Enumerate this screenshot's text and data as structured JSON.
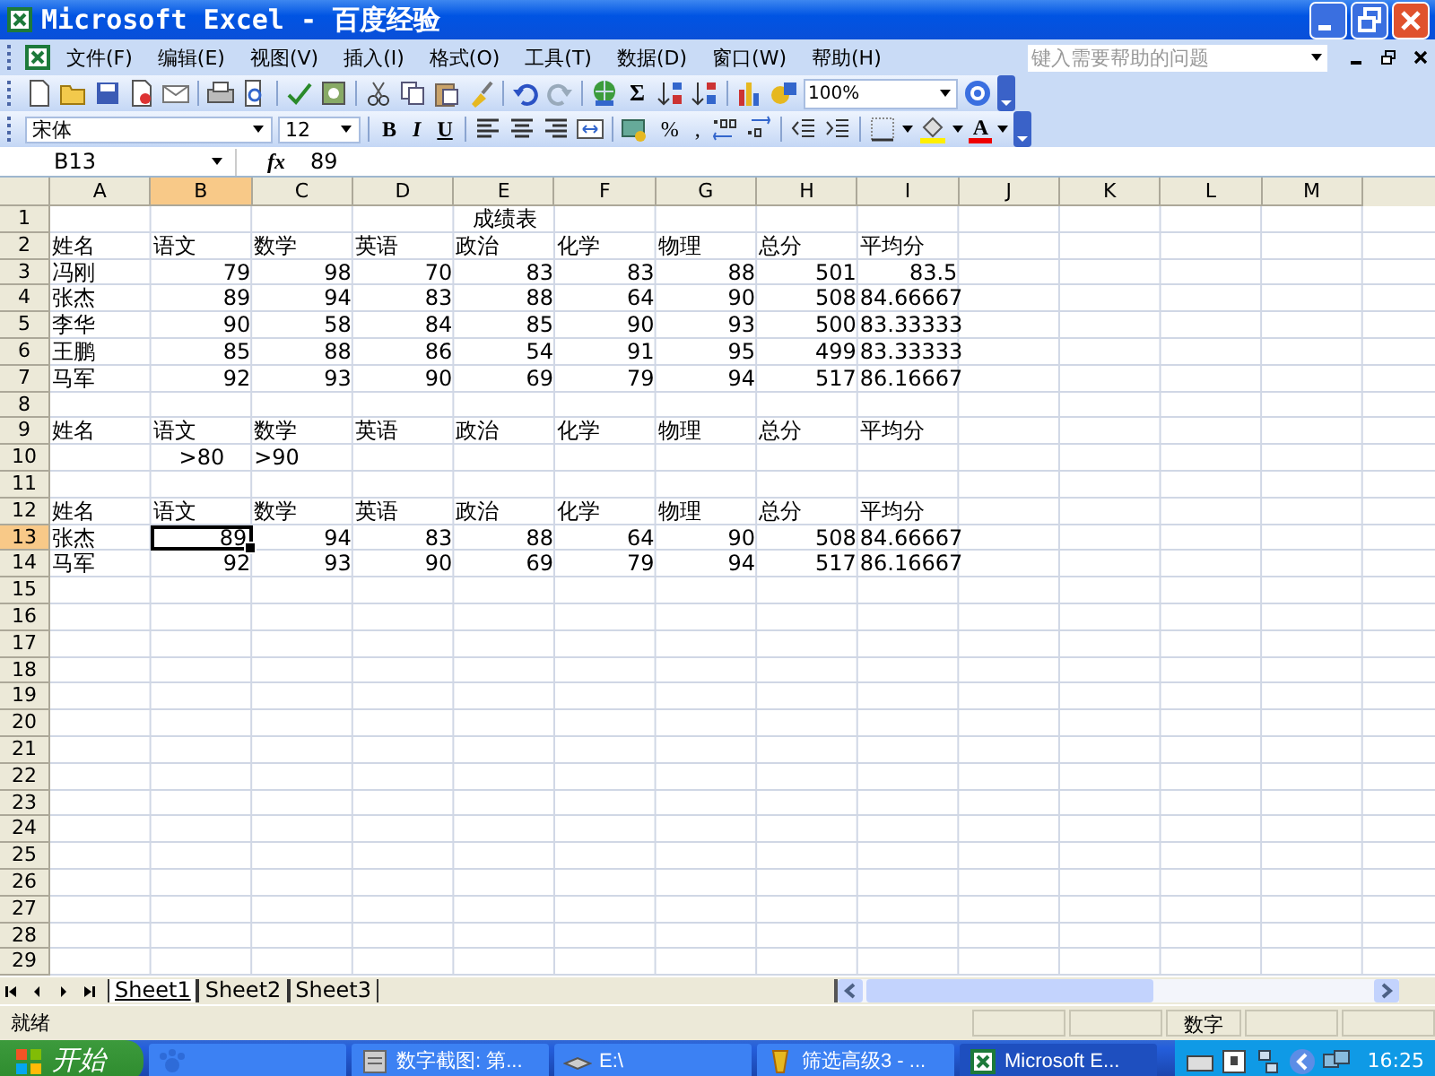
{
  "window": {
    "title": "Microsoft Excel - 百度经验"
  },
  "menu": [
    "文件(F)",
    "编辑(E)",
    "视图(V)",
    "插入(I)",
    "格式(O)",
    "工具(T)",
    "数据(D)",
    "窗口(W)",
    "帮助(H)"
  ],
  "help_box": {
    "placeholder": "键入需要帮助的问题"
  },
  "toolbar": {
    "sum": "Σ",
    "zoom": "100%"
  },
  "format_toolbar": {
    "font": "宋体",
    "size": "12",
    "bold": "B",
    "italic": "I",
    "underline": "U",
    "percent": "%",
    "comma": ",",
    "font_color": "A"
  },
  "formula_bar": {
    "name_box": "B13",
    "fx": "fx",
    "value": "89"
  },
  "columns": [
    {
      "label": "A",
      "selected": false
    },
    {
      "label": "B",
      "selected": true
    },
    {
      "label": "C",
      "selected": false
    },
    {
      "label": "D",
      "selected": false
    },
    {
      "label": "E",
      "selected": false
    },
    {
      "label": "F",
      "selected": false
    },
    {
      "label": "G",
      "selected": false
    },
    {
      "label": "H",
      "selected": false
    },
    {
      "label": "I",
      "selected": false
    },
    {
      "label": "J",
      "selected": false
    },
    {
      "label": "K",
      "selected": false
    },
    {
      "label": "L",
      "selected": false
    },
    {
      "label": "M",
      "selected": false
    }
  ],
  "rows": [
    {
      "label": "1",
      "selected": false,
      "cells": [
        null,
        null,
        null,
        null,
        {
          "text": "成绩表",
          "kind": "title"
        }
      ]
    },
    {
      "label": "2",
      "selected": false,
      "cells": [
        {
          "text": "姓名",
          "kind": "text"
        },
        {
          "text": "语文",
          "kind": "text"
        },
        {
          "text": "数学",
          "kind": "text"
        },
        {
          "text": "英语",
          "kind": "text"
        },
        {
          "text": "政治",
          "kind": "text"
        },
        {
          "text": "化学",
          "kind": "text"
        },
        {
          "text": "物理",
          "kind": "text"
        },
        {
          "text": "总分",
          "kind": "text"
        },
        {
          "text": "平均分",
          "kind": "text"
        }
      ]
    },
    {
      "label": "3",
      "selected": false,
      "cells": [
        {
          "text": "冯刚",
          "kind": "text"
        },
        {
          "text": "79",
          "kind": "number"
        },
        {
          "text": "98",
          "kind": "number"
        },
        {
          "text": "70",
          "kind": "number"
        },
        {
          "text": "83",
          "kind": "number"
        },
        {
          "text": "83",
          "kind": "number"
        },
        {
          "text": "88",
          "kind": "number"
        },
        {
          "text": "501",
          "kind": "number"
        },
        {
          "text": "83.5",
          "kind": "number"
        }
      ]
    },
    {
      "label": "4",
      "selected": false,
      "cells": [
        {
          "text": "张杰",
          "kind": "text"
        },
        {
          "text": "89",
          "kind": "number"
        },
        {
          "text": "94",
          "kind": "number"
        },
        {
          "text": "83",
          "kind": "number"
        },
        {
          "text": "88",
          "kind": "number"
        },
        {
          "text": "64",
          "kind": "number"
        },
        {
          "text": "90",
          "kind": "number"
        },
        {
          "text": "508",
          "kind": "number"
        },
        {
          "text": "84.66667",
          "kind": "number"
        }
      ]
    },
    {
      "label": "5",
      "selected": false,
      "cells": [
        {
          "text": "李华",
          "kind": "text"
        },
        {
          "text": "90",
          "kind": "number"
        },
        {
          "text": "58",
          "kind": "number"
        },
        {
          "text": "84",
          "kind": "number"
        },
        {
          "text": "85",
          "kind": "number"
        },
        {
          "text": "90",
          "kind": "number"
        },
        {
          "text": "93",
          "kind": "number"
        },
        {
          "text": "500",
          "kind": "number"
        },
        {
          "text": "83.33333",
          "kind": "number"
        }
      ]
    },
    {
      "label": "6",
      "selected": false,
      "cells": [
        {
          "text": "王鹏",
          "kind": "text"
        },
        {
          "text": "85",
          "kind": "number"
        },
        {
          "text": "88",
          "kind": "number"
        },
        {
          "text": "86",
          "kind": "number"
        },
        {
          "text": "54",
          "kind": "number"
        },
        {
          "text": "91",
          "kind": "number"
        },
        {
          "text": "95",
          "kind": "number"
        },
        {
          "text": "499",
          "kind": "number"
        },
        {
          "text": "83.33333",
          "kind": "number"
        }
      ]
    },
    {
      "label": "7",
      "selected": false,
      "cells": [
        {
          "text": "马军",
          "kind": "text"
        },
        {
          "text": "92",
          "kind": "number"
        },
        {
          "text": "93",
          "kind": "number"
        },
        {
          "text": "90",
          "kind": "number"
        },
        {
          "text": "69",
          "kind": "number"
        },
        {
          "text": "79",
          "kind": "number"
        },
        {
          "text": "94",
          "kind": "number"
        },
        {
          "text": "517",
          "kind": "number"
        },
        {
          "text": "86.16667",
          "kind": "number"
        }
      ]
    },
    {
      "label": "8",
      "selected": false
    },
    {
      "label": "9",
      "selected": false,
      "cells": [
        {
          "text": "姓名",
          "kind": "text"
        },
        {
          "text": "语文",
          "kind": "text"
        },
        {
          "text": "数学",
          "kind": "text"
        },
        {
          "text": "英语",
          "kind": "text"
        },
        {
          "text": "政治",
          "kind": "text"
        },
        {
          "text": "化学",
          "kind": "text"
        },
        {
          "text": "物理",
          "kind": "text"
        },
        {
          "text": "总分",
          "kind": "text"
        },
        {
          "text": "平均分",
          "kind": "text"
        }
      ]
    },
    {
      "label": "10",
      "selected": false,
      "cells": [
        null,
        {
          "text": ">80",
          "kind": "title"
        },
        {
          "text": ">90",
          "kind": "text"
        }
      ]
    },
    {
      "label": "11",
      "selected": false
    },
    {
      "label": "12",
      "selected": false,
      "cells": [
        {
          "text": "姓名",
          "kind": "text"
        },
        {
          "text": "语文",
          "kind": "text"
        },
        {
          "text": "数学",
          "kind": "text"
        },
        {
          "text": "英语",
          "kind": "text"
        },
        {
          "text": "政治",
          "kind": "text"
        },
        {
          "text": "化学",
          "kind": "text"
        },
        {
          "text": "物理",
          "kind": "text"
        },
        {
          "text": "总分",
          "kind": "text"
        },
        {
          "text": "平均分",
          "kind": "text"
        }
      ]
    },
    {
      "label": "13",
      "selected": true,
      "cells": [
        {
          "text": "张杰",
          "kind": "text"
        },
        {
          "text": "89",
          "kind": "number"
        },
        {
          "text": "94",
          "kind": "number"
        },
        {
          "text": "83",
          "kind": "number"
        },
        {
          "text": "88",
          "kind": "number"
        },
        {
          "text": "64",
          "kind": "number"
        },
        {
          "text": "90",
          "kind": "number"
        },
        {
          "text": "508",
          "kind": "number"
        },
        {
          "text": "84.66667",
          "kind": "number"
        }
      ]
    },
    {
      "label": "14",
      "selected": false,
      "cells": [
        {
          "text": "马军",
          "kind": "text"
        },
        {
          "text": "92",
          "kind": "number"
        },
        {
          "text": "93",
          "kind": "number"
        },
        {
          "text": "90",
          "kind": "number"
        },
        {
          "text": "69",
          "kind": "number"
        },
        {
          "text": "79",
          "kind": "number"
        },
        {
          "text": "94",
          "kind": "number"
        },
        {
          "text": "517",
          "kind": "number"
        },
        {
          "text": "86.16667",
          "kind": "number"
        }
      ]
    },
    {
      "label": "15",
      "selected": false
    },
    {
      "label": "16",
      "selected": false
    },
    {
      "label": "17",
      "selected": false
    },
    {
      "label": "18",
      "selected": false
    },
    {
      "label": "19",
      "selected": false
    },
    {
      "label": "20",
      "selected": false
    },
    {
      "label": "21",
      "selected": false
    },
    {
      "label": "22",
      "selected": false
    },
    {
      "label": "23",
      "selected": false
    },
    {
      "label": "24",
      "selected": false
    },
    {
      "label": "25",
      "selected": false
    },
    {
      "label": "26",
      "selected": false
    },
    {
      "label": "27",
      "selected": false
    },
    {
      "label": "28",
      "selected": false
    },
    {
      "label": "29",
      "selected": false
    }
  ],
  "sheet_tabs": [
    {
      "label": "Sheet1",
      "selected": true
    },
    {
      "label": "Sheet2",
      "selected": false
    },
    {
      "label": "Sheet3",
      "selected": false
    }
  ],
  "status_bar": {
    "state": "就绪",
    "mode": "数字"
  },
  "taskbar": {
    "start": "开始",
    "tasks": [
      {
        "label": "数字截图: 第...",
        "selected": false
      },
      {
        "label": "E:\\",
        "selected": false
      },
      {
        "label": "筛选高级3 - ...",
        "selected": false
      },
      {
        "label": "Microsoft E...",
        "selected": true
      }
    ],
    "time": "16:25"
  }
}
